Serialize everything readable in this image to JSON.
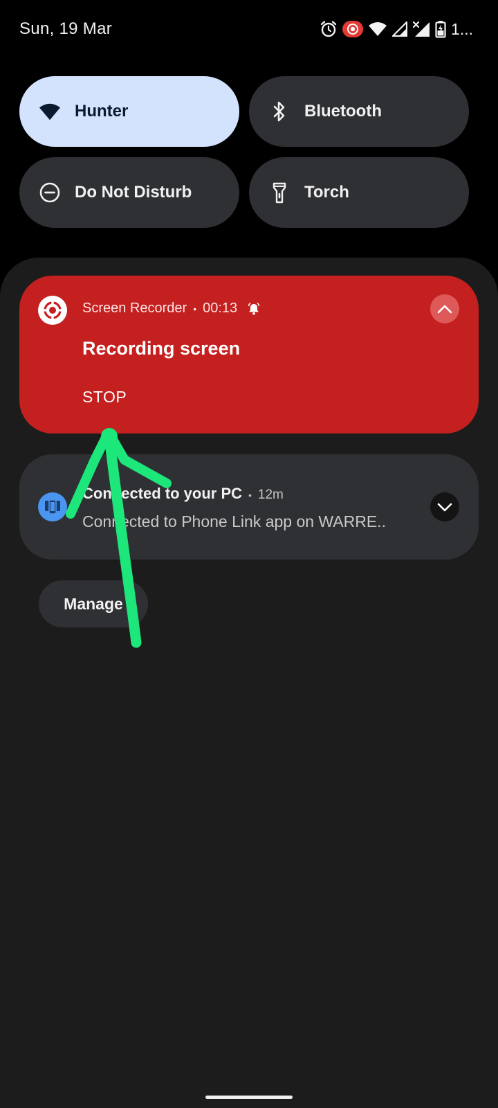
{
  "status_bar": {
    "date": "Sun, 19 Mar",
    "battery_text": "1...",
    "icons": [
      "alarm-icon",
      "screen-record-icon",
      "wifi-icon",
      "signal-icon",
      "signal-no-service-icon",
      "battery-charging-icon"
    ]
  },
  "quick_settings": {
    "tiles": [
      {
        "label": "Hunter",
        "icon": "wifi-icon",
        "active": true
      },
      {
        "label": "Bluetooth",
        "icon": "bluetooth-icon",
        "active": false
      },
      {
        "label": "Do Not Disturb",
        "icon": "do-not-disturb-icon",
        "active": false
      },
      {
        "label": "Torch",
        "icon": "torch-icon",
        "active": false
      }
    ]
  },
  "notifications": {
    "recorder": {
      "app_name": "Screen Recorder",
      "time": "00:13",
      "title": "Recording screen",
      "action": "STOP",
      "color": "#c4201f"
    },
    "phone_link": {
      "title": "Connected to your PC",
      "time": "12m",
      "text": "Connected to Phone Link app on WARRE.."
    }
  },
  "manage_label": "Manage",
  "colors": {
    "active_tile": "#d3e3fd",
    "tile": "#2f3033",
    "shade": "#1c1c1c",
    "annotation": "#1de67a"
  }
}
